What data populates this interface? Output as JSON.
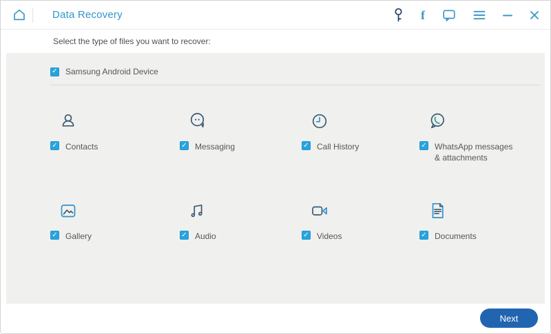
{
  "header": {
    "title": "Data Recovery"
  },
  "instruction": "Select the type of files you want to recover:",
  "device": {
    "label": "Samsung Android Device",
    "checked": true
  },
  "file_types": [
    {
      "label": "Contacts",
      "checked": true
    },
    {
      "label": "Messaging",
      "checked": true
    },
    {
      "label": "Call History",
      "checked": true
    },
    {
      "label": "WhatsApp messages & attachments",
      "checked": true
    },
    {
      "label": "Gallery",
      "checked": true
    },
    {
      "label": "Audio",
      "checked": true
    },
    {
      "label": "Videos",
      "checked": true
    },
    {
      "label": "Documents",
      "checked": true
    }
  ],
  "footer": {
    "next_label": "Next"
  },
  "glyphs": {
    "check": "✓",
    "facebook": "f"
  },
  "colors": {
    "accent_blue": "#2e96cc",
    "checkbox_blue": "#28a4dd",
    "button_blue": "#2165b0",
    "icon_dark": "#3b5a73",
    "icon_blue": "#2e93cc",
    "icon_teal": "#23a6a0",
    "panel_gray": "#f0f0ee"
  }
}
